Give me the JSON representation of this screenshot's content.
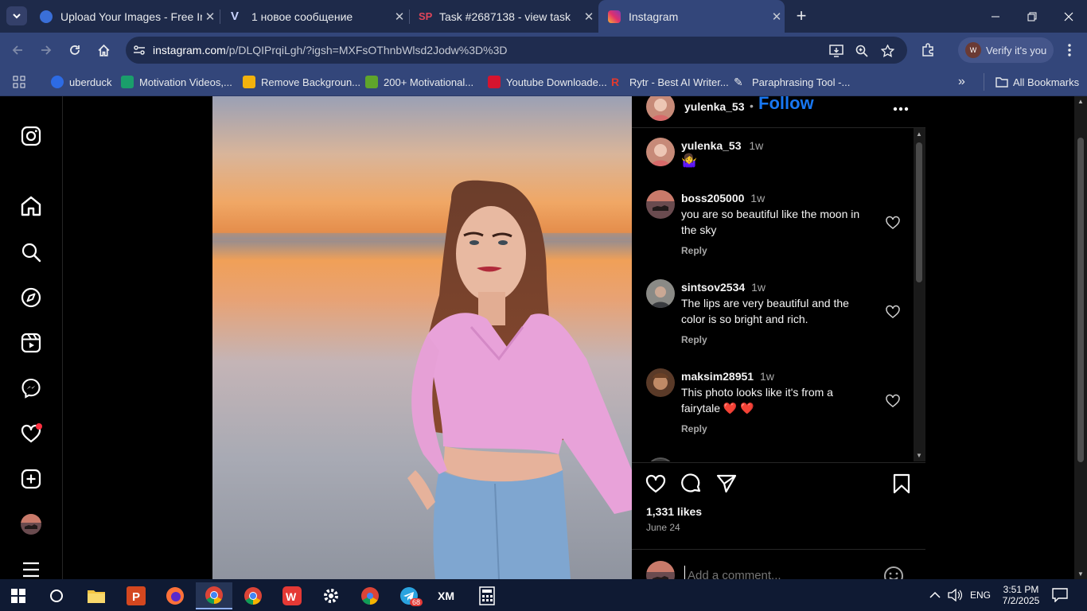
{
  "browser": {
    "tabs": [
      {
        "title": "Upload Your Images - Free Ima",
        "active": false
      },
      {
        "title": "1 новое сообщение",
        "active": false
      },
      {
        "title": "Task #2687138 - view task",
        "active": false
      },
      {
        "title": "Instagram",
        "active": true
      }
    ],
    "url_host": "instagram.com",
    "url_path": "/p/DLQIPrqiLgh/?igsh=MXFsOThnbWlsd2Jodw%3D%3D",
    "profile_label": "Verify it's you",
    "profile_initial": "W",
    "bookmarks": [
      {
        "label": "uberduck",
        "color": "#2d6be4"
      },
      {
        "label": "Motivation Videos,...",
        "color": "#1a9e6b"
      },
      {
        "label": "Remove Backgroun...",
        "color": "#f2b20d"
      },
      {
        "label": "200+ Motivational...",
        "color": "#5fa52b"
      },
      {
        "label": "Youtube Downloade...",
        "color": "#d6142e"
      },
      {
        "label": "Rytr - Best AI Writer...",
        "color": "#e03a2f"
      },
      {
        "label": "Paraphrasing Tool -...",
        "color": "#c9c9c9"
      }
    ],
    "all_bookmarks_label": "All Bookmarks"
  },
  "post": {
    "author": "yulenka_53",
    "follow_label": "Follow",
    "separator": "•",
    "caption_time": "1w",
    "caption_emoji": "🤷‍♀️",
    "comments": [
      {
        "user": "boss205000",
        "time": "1w",
        "text": "you are so beautiful like the moon in the sky",
        "reply": "Reply"
      },
      {
        "user": "sintsov2534",
        "time": "1w",
        "text": "The lips are very beautiful and the color is so bright and rich.",
        "reply": "Reply"
      },
      {
        "user": "maksim28951",
        "time": "1w",
        "text": "This photo looks like it's from a fairytale ❤️ ❤️",
        "reply": "Reply"
      }
    ],
    "likes": "1,331 likes",
    "date": "June 24",
    "comment_placeholder": "Add a comment..."
  },
  "taskbar": {
    "lang": "ENG",
    "time": "3:51 PM",
    "date": "7/2/2025",
    "telegram_badge": "68"
  },
  "colors": {
    "follow": "#1877f2",
    "tabbar": "#1e2a4a",
    "toolbar": "#33467a",
    "notification": "#ff3040"
  }
}
